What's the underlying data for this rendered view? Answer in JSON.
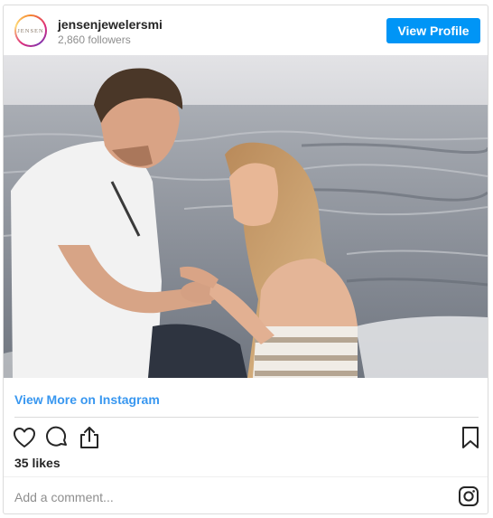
{
  "header": {
    "avatar_text": "JENSEN",
    "username": "jensenjewelersmi",
    "followers": "2,860 followers",
    "view_profile_label": "View Profile"
  },
  "post": {
    "image_subject": "beach-proposal-photo",
    "view_more_label": "View More on Instagram",
    "likes": "35 likes",
    "comment_placeholder": "Add a comment..."
  },
  "icons": {
    "like": "heart-icon",
    "comment": "comment-bubble-icon",
    "share": "share-icon",
    "save": "bookmark-icon",
    "instagram": "instagram-logo-icon"
  },
  "colors": {
    "accent": "#0095f6",
    "link": "#3897f0",
    "text": "#262626",
    "muted": "#8e8e8e",
    "border": "#dbdbdb"
  }
}
